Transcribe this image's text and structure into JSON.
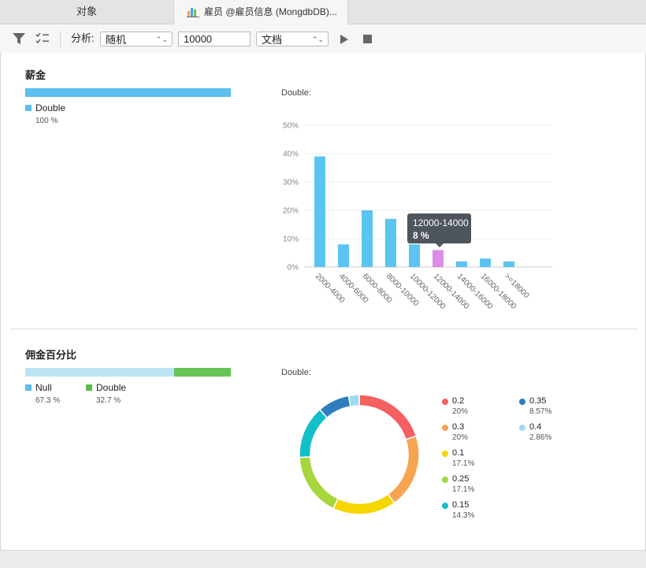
{
  "tabs": {
    "objects_label": "对象",
    "active_label": "雇员 @雇员信息 (MongdbDB)..."
  },
  "toolbar": {
    "filter_icon": "filter-icon",
    "fields_icon": "field-list-icon",
    "analyze_label": "分析:",
    "sampling_select": "随机",
    "sample_size": "10000",
    "mode_select": "文档",
    "run_icon": "play-icon",
    "stop_icon": "stop-icon"
  },
  "salary": {
    "title": "薪金",
    "types": [
      {
        "name": "Double",
        "pct": "100 %",
        "fraction": 1.0,
        "color": "#5bbfef"
      }
    ],
    "chart_caption": "Double:"
  },
  "commission": {
    "title": "佣金百分比",
    "types": [
      {
        "name": "Null",
        "pct": "67.3 %",
        "fraction": 0.673,
        "color": "#5bbfef",
        "bar_color": "#bde4f5"
      },
      {
        "name": "Double",
        "pct": "32.7 %",
        "fraction": 0.327,
        "color": "#5cbd4f",
        "bar_color": "#68c455"
      }
    ],
    "chart_caption": "Double:"
  },
  "tooltip": {
    "label": "12000-14000",
    "value": "8 %"
  },
  "chart_data": [
    {
      "type": "bar",
      "categories": [
        "2000-4000",
        "4000-6000",
        "6000-8000",
        "8000-10000",
        "10000-12000",
        "12000-14000",
        "14000-16000",
        "16000-18000",
        ">=18000"
      ],
      "values": [
        39,
        8,
        20,
        17,
        8,
        6,
        2,
        3,
        2
      ],
      "ylim": [
        0,
        50
      ],
      "yticks": [
        "0%",
        "10%",
        "20%",
        "30%",
        "40%",
        "50%"
      ],
      "grid": true,
      "bar_color": "#5bc4f1",
      "highlight_index": 5,
      "highlight_color": "#dc8ee6"
    },
    {
      "type": "pie",
      "donut": true,
      "slices": [
        {
          "label": "0.2",
          "pct": "20%",
          "value": 20,
          "color": "#f4605f"
        },
        {
          "label": "0.3",
          "pct": "20%",
          "value": 20,
          "color": "#f6a452"
        },
        {
          "label": "0.1",
          "pct": "17.1%",
          "value": 17.1,
          "color": "#f6d600"
        },
        {
          "label": "0.25",
          "pct": "17.1%",
          "value": 17.1,
          "color": "#a6d63c"
        },
        {
          "label": "0.15",
          "pct": "14.3%",
          "value": 14.3,
          "color": "#12bfc9"
        },
        {
          "label": "0.35",
          "pct": "8.57%",
          "value": 8.57,
          "color": "#2f7dbf"
        },
        {
          "label": "0.4",
          "pct": "2.86%",
          "value": 2.86,
          "color": "#9fdcf0"
        }
      ]
    }
  ]
}
